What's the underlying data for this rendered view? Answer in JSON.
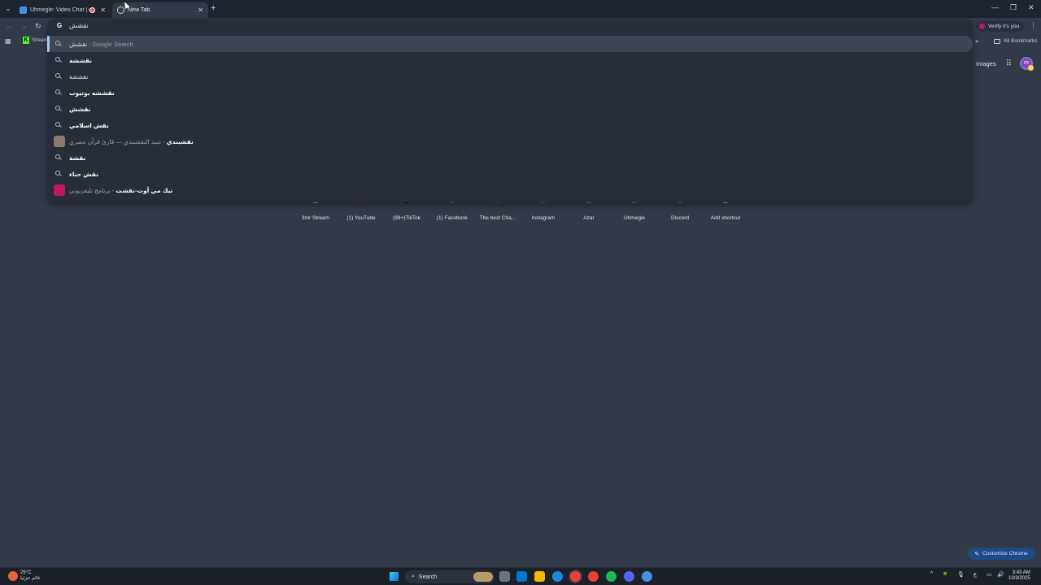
{
  "browser": {
    "tabs": [
      {
        "title": "Uhmegle: Video Chat | Omegle",
        "recording": true,
        "favicon_color": "#4a90e2"
      },
      {
        "title": "New Tab",
        "active": true
      }
    ],
    "verify_label": "Verify it's you",
    "bookmarks": [
      {
        "label": "Stream"
      }
    ],
    "all_bookmarks_label": "All Bookmarks"
  },
  "omnibox": {
    "query": "نقشش",
    "suggestions": [
      {
        "text": "نقشش",
        "suffix": "- Google Search",
        "type": "search",
        "highlighted": true
      },
      {
        "text": "نقششه",
        "type": "search"
      },
      {
        "text": "نقششة",
        "type": "search"
      },
      {
        "text": "نقششه بوتيوب",
        "type": "search"
      },
      {
        "text": "نقشش",
        "type": "search"
      },
      {
        "text": "نقش اسلامي",
        "type": "search"
      },
      {
        "text": "نقشبندي",
        "suffix": "- سيد النقشبندي — قارئ قرآن مصري",
        "type": "entity",
        "thumb_color": "#8a7b6a"
      },
      {
        "text": "نقشة",
        "type": "search"
      },
      {
        "text": "نقش حناء",
        "type": "search"
      },
      {
        "text": "تيك مي أوت-نقشت",
        "suffix": "- برنامج تليفزيوني",
        "type": "entity",
        "thumb_color": "#c2185b"
      }
    ]
  },
  "ntp": {
    "images_label": "Images",
    "avatar_letter": "m",
    "shortcuts": [
      {
        "label": "3mr Stream",
        "color": "#53fc18"
      },
      {
        "label": "(1) YouTube",
        "color": "#ff0000"
      },
      {
        "label": "(99+)TikTok",
        "color": "#000000"
      },
      {
        "label": "(1) Facebook",
        "color": "#1877f2"
      },
      {
        "label": "The best Cha...",
        "color": "#555555"
      },
      {
        "label": "Instagram",
        "color": "#e1306c"
      },
      {
        "label": "Azar",
        "color": "#1ec467"
      },
      {
        "label": "Uhmegle",
        "color": "#4a90e2"
      },
      {
        "label": "Discord",
        "color": "#5865f2"
      },
      {
        "label": "Add shortcut",
        "color": "#8ab4f8"
      }
    ],
    "customize_label": "Customize Chrome"
  },
  "taskbar": {
    "weather_temp": "25°C",
    "weather_desc": "غائم جزئيا",
    "search_label": "Search",
    "time": "3:43 AM",
    "date": "10/3/2025",
    "lang": "ع"
  }
}
